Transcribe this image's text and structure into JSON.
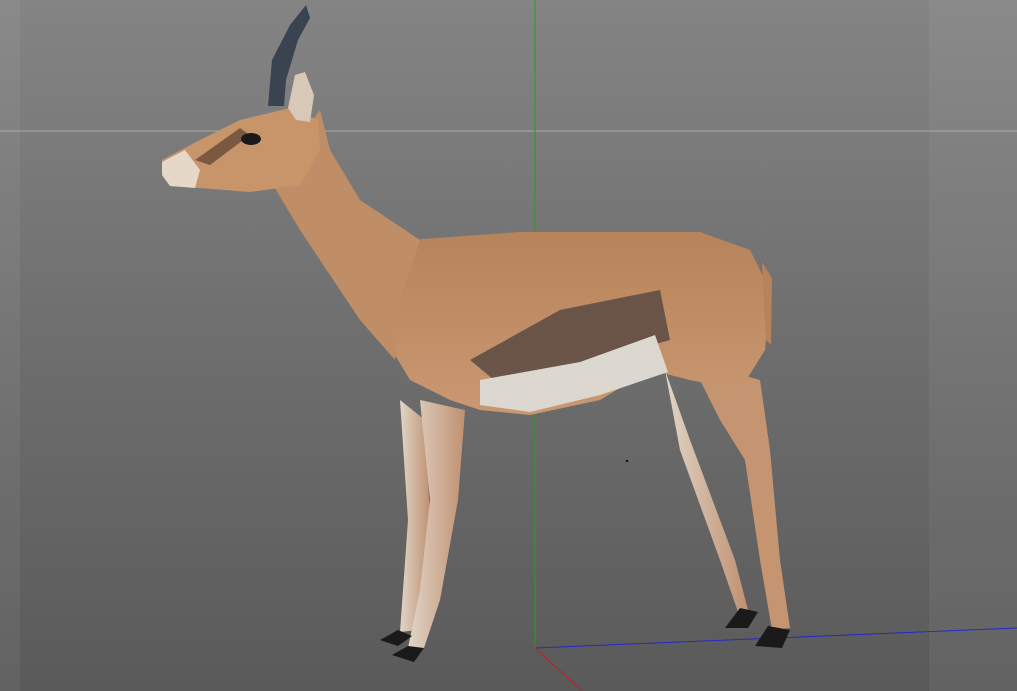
{
  "viewport": {
    "background_top": "#848484",
    "background_bottom": "#5a5a5a",
    "horizon_line_color": "#a8a8a8",
    "axes": {
      "x_color": "#c02020",
      "y_color": "#20a020",
      "z_color": "#2020c0"
    },
    "model": {
      "subject": "gazelle",
      "coat_color": "#c08a5c",
      "belly_color": "#dcd8d0",
      "horn_color": "#3a4450",
      "hoof_color": "#1a1a1a"
    }
  }
}
